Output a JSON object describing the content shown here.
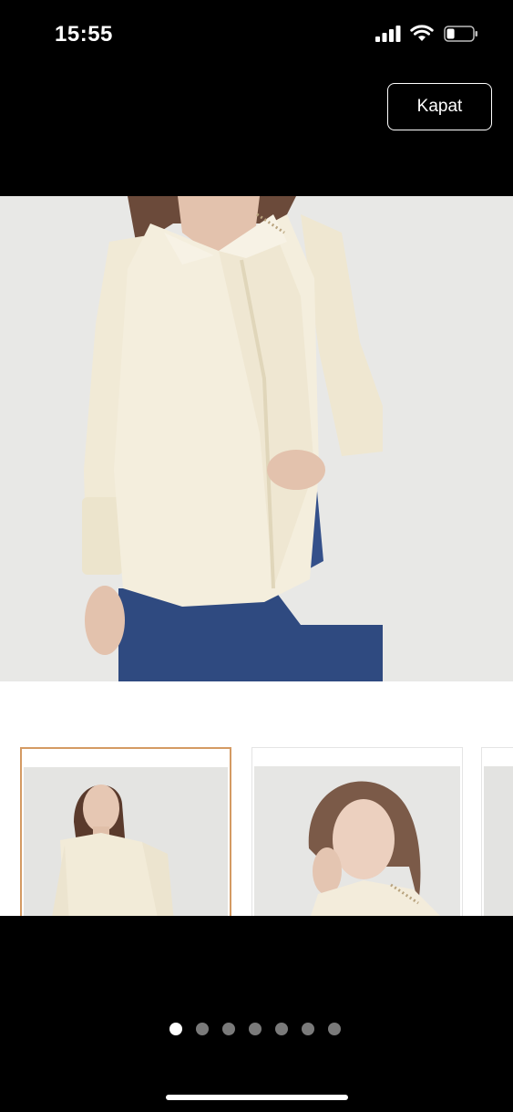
{
  "status_bar": {
    "time": "15:55",
    "signal_icon": "signal-bars-icon",
    "wifi_icon": "wifi-icon",
    "battery_icon": "battery-icon",
    "battery_level": 0.3
  },
  "header": {
    "close_label": "Kapat"
  },
  "gallery": {
    "main_image": "product-photo-blouse",
    "thumbnails": [
      {
        "image": "model-full-front",
        "selected": true
      },
      {
        "image": "model-portrait",
        "selected": false
      },
      {
        "image": "model-partial",
        "selected": false
      }
    ],
    "page_count": 7,
    "current_page": 1
  },
  "colors": {
    "background": "#000000",
    "selected_border": "#d49a63",
    "dot_inactive": "#7a7a7a",
    "dot_active": "#ffffff"
  }
}
